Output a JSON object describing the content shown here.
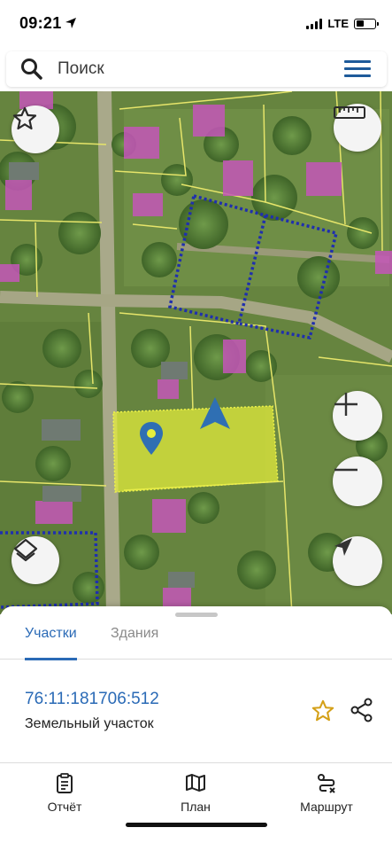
{
  "status_bar": {
    "time": "09:21",
    "network": "LTE"
  },
  "search": {
    "placeholder": "Поиск"
  },
  "map": {
    "buttons": [
      "favorite",
      "ruler",
      "zoom-in",
      "zoom-out",
      "layers",
      "my-location"
    ],
    "parcel_highlight_color": "#e6ee3c",
    "boundary_line_color": "#1f2fae",
    "plot_lines_color": "#e9e86a"
  },
  "sheet": {
    "tabs": [
      {
        "label": "Участки",
        "active": true
      },
      {
        "label": "Здания",
        "active": false
      }
    ],
    "parcel": {
      "cadastral_number": "76:11:181706:512",
      "type": "Земельный участок"
    }
  },
  "bottom_nav": [
    {
      "label": "Отчёт",
      "icon": "report-icon"
    },
    {
      "label": "План",
      "icon": "map-plan-icon"
    },
    {
      "label": "Маршрут",
      "icon": "route-icon"
    }
  ],
  "colors": {
    "accent": "#2a6ab6",
    "menu": "#1e5a9a",
    "favorite": "#d4a017"
  }
}
